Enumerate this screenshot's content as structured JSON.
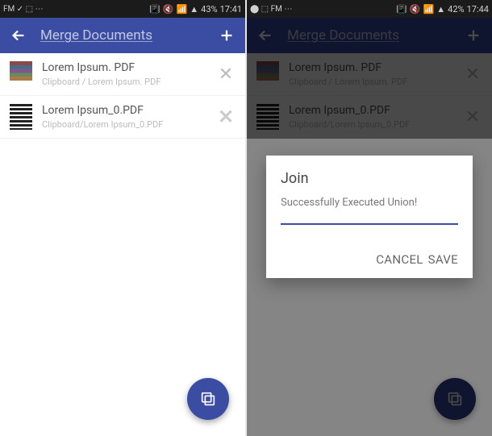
{
  "left": {
    "status": {
      "left_text": "FM ✓ ⬚ ⋯",
      "battery": "43%",
      "time": "17:41"
    },
    "appbar": {
      "title": "Merge Documents"
    },
    "files": [
      {
        "name": "Lorem Ipsum. PDF",
        "path": "Clipboard / Lorem Ipsum. PDF"
      },
      {
        "name": "Lorem Ipsum_0.PDF",
        "path": "Clipboard/Lorem Ipsum_0.PDF"
      }
    ]
  },
  "right": {
    "status": {
      "left_text": "⬤ ⬚ FM ⋯",
      "battery": "42%",
      "time": "17:44"
    },
    "appbar": {
      "title": "Merge Documents"
    },
    "files": [
      {
        "name": "Lorem Ipsum. PDF",
        "path": "Clipboard / Lorem Ipsum. PDF"
      },
      {
        "name": "Lorem Ipsum_0.PDF",
        "path": "Clipboard/Lorem Ipsum_0.PDF"
      }
    ],
    "dialog": {
      "title": "Join",
      "message": "Successfully Executed Union!",
      "cancel": "CANCEL",
      "save": "SAVE"
    }
  }
}
